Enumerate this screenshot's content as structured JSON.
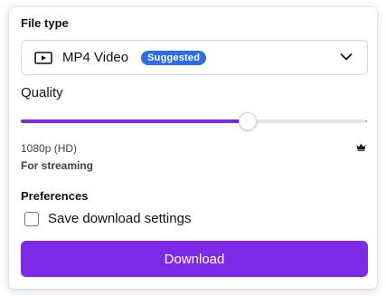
{
  "file_type": {
    "label": "File type",
    "selected": "MP4 Video",
    "badge": "Suggested",
    "icon": "video-play-icon"
  },
  "quality": {
    "label": "Quality",
    "level_fraction": 0.66,
    "resolution": "1080p (HD)",
    "description": "For streaming",
    "premium_icon": "crown-icon"
  },
  "preferences": {
    "label": "Preferences",
    "save_settings_label": "Save download settings",
    "save_settings_checked": false
  },
  "actions": {
    "download_label": "Download"
  },
  "colors": {
    "accent": "#7d2ae8",
    "badge": "#2e6be6"
  }
}
